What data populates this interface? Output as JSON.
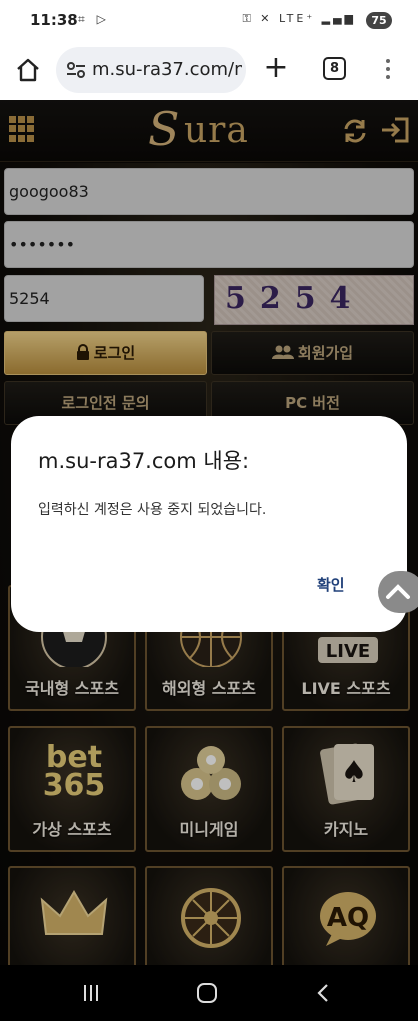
{
  "status_bar": {
    "time": "11:38",
    "battery": "75",
    "network": "LTE⁺"
  },
  "browser": {
    "url": "m.su-ra37.com/m",
    "tab_count": "8"
  },
  "site": {
    "logo_initial": "S",
    "logo_rest": "ura"
  },
  "login_form": {
    "username_value": "googoo83",
    "password_value": "•••••••",
    "captcha_input_value": "5254",
    "captcha_image_text": "5254",
    "login_label": "로그인",
    "signup_label": "회원가입",
    "inquiry_label": "로그인전 문의",
    "pc_version_label": "PC 버전"
  },
  "games": [
    {
      "label": "국내형 스포츠",
      "icon": "soccer-ball-icon"
    },
    {
      "label": "해외형 스포츠",
      "icon": "basketball-icon"
    },
    {
      "label": "LIVE 스포츠",
      "icon": "live-icon"
    },
    {
      "label": "가상 스포츠",
      "icon": "bet365-icon"
    },
    {
      "label": "미니게임",
      "icon": "billiard-balls-icon"
    },
    {
      "label": "카지노",
      "icon": "playing-cards-icon"
    },
    {
      "label": "",
      "icon": "crown-icon"
    },
    {
      "label": "",
      "icon": "roulette-wheel-icon"
    },
    {
      "label": "",
      "icon": "question-bubble-icon"
    }
  ],
  "dialog": {
    "title": "m.su-ra37.com 내용:",
    "message": "입력하신 계정은 사용 중지 되었습니다.",
    "ok_label": "확인"
  },
  "colors": {
    "gold": "#c9a565",
    "dialog_button": "#21417a"
  }
}
